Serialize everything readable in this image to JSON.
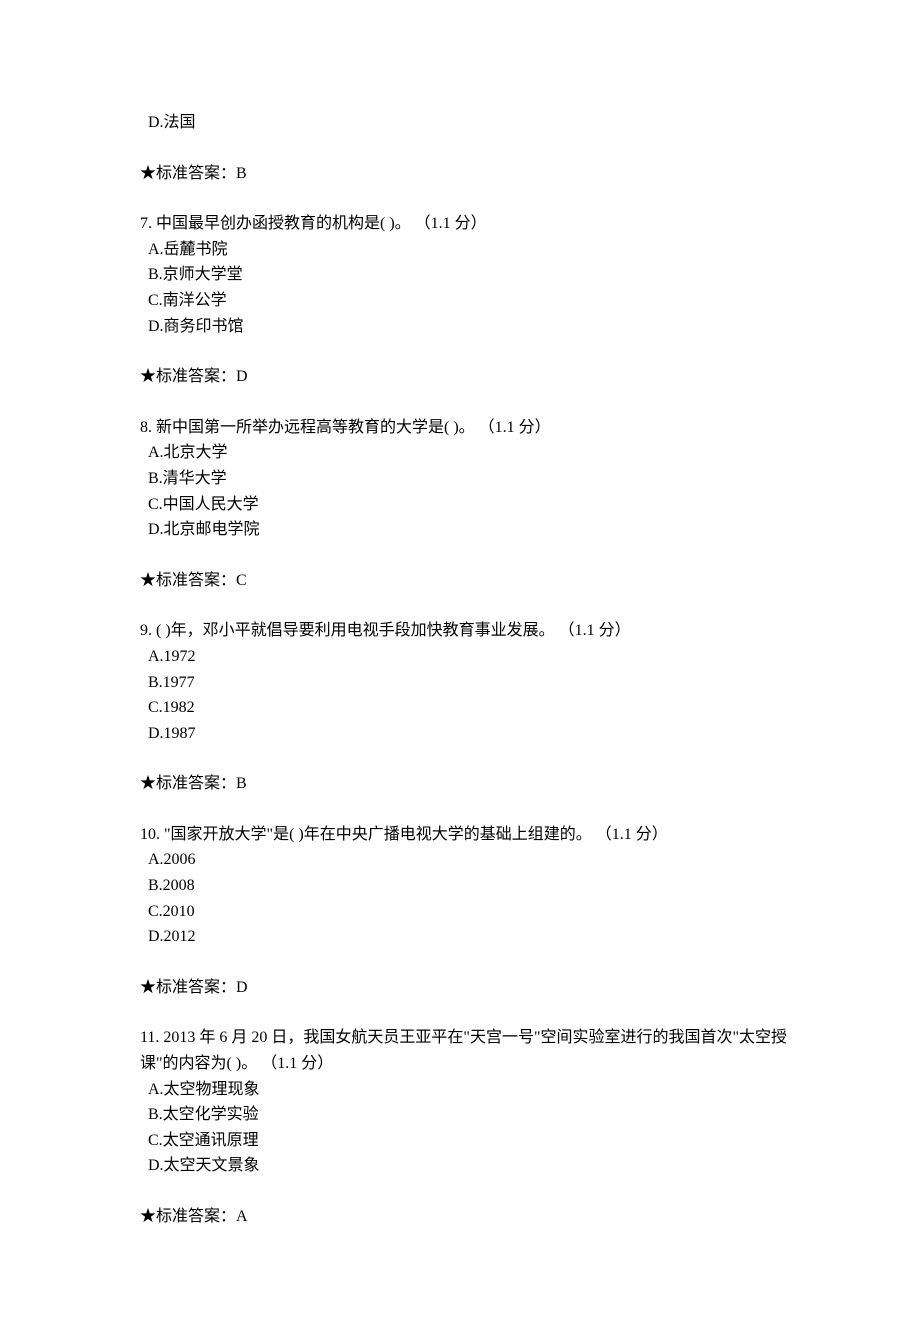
{
  "q6": {
    "optD": "D.法国",
    "answer": "★标准答案：B"
  },
  "q7": {
    "stem": "7. 中国最早创办函授教育的机构是( )。 （1.1 分）",
    "optA": "A.岳麓书院",
    "optB": "B.京师大学堂",
    "optC": "C.南洋公学",
    "optD": "D.商务印书馆",
    "answer": "★标准答案：D"
  },
  "q8": {
    "stem": "8. 新中国第一所举办远程高等教育的大学是( )。 （1.1 分）",
    "optA": "A.北京大学",
    "optB": "B.清华大学",
    "optC": "C.中国人民大学",
    "optD": "D.北京邮电学院",
    "answer": "★标准答案：C"
  },
  "q9": {
    "stem": "9. ( )年，邓小平就倡导要利用电视手段加快教育事业发展。 （1.1 分）",
    "optA": "A.1972",
    "optB": "B.1977",
    "optC": "C.1982",
    "optD": "D.1987",
    "answer": "★标准答案：B"
  },
  "q10": {
    "stem": "10. \"国家开放大学\"是( )年在中央广播电视大学的基础上组建的。 （1.1 分）",
    "optA": "A.2006",
    "optB": "B.2008",
    "optC": "C.2010",
    "optD": "D.2012",
    "answer": "★标准答案：D"
  },
  "q11": {
    "stem": "11. 2013 年 6 月 20 日，我国女航天员王亚平在\"天宫一号\"空间实验室进行的我国首次\"太空授课\"的内容为( )。 （1.1 分）",
    "optA": "A.太空物理现象",
    "optB": "B.太空化学实验",
    "optC": "C.太空通讯原理",
    "optD": "D.太空天文景象",
    "answer": "★标准答案：A"
  }
}
